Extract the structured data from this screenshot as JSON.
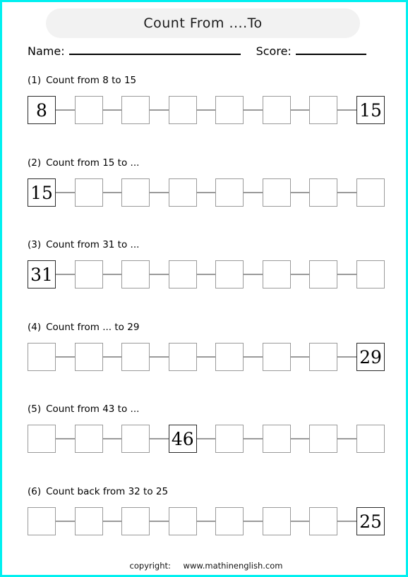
{
  "header": {
    "title": "Count From ....To",
    "name_label": "Name:",
    "score_label": "Score:"
  },
  "questions": [
    {
      "number": "(1)",
      "text": "Count from 8 to 15",
      "cells": [
        "8",
        "",
        "",
        "",
        "",
        "",
        "",
        "15"
      ]
    },
    {
      "number": "(2)",
      "text": "Count from 15 to ...",
      "cells": [
        "15",
        "",
        "",
        "",
        "",
        "",
        "",
        ""
      ]
    },
    {
      "number": "(3)",
      "text": "Count from 31 to ...",
      "cells": [
        "31",
        "",
        "",
        "",
        "",
        "",
        "",
        ""
      ]
    },
    {
      "number": "(4)",
      "text": "Count from ... to 29",
      "cells": [
        "",
        "",
        "",
        "",
        "",
        "",
        "",
        "29"
      ]
    },
    {
      "number": "(5)",
      "text": "Count from 43 to ...",
      "cells": [
        "",
        "",
        "",
        "46",
        "",
        "",
        "",
        ""
      ]
    },
    {
      "number": "(6)",
      "text": "Count back from 32 to 25",
      "cells": [
        "",
        "",
        "",
        "",
        "",
        "",
        "",
        "25"
      ]
    }
  ],
  "footer": {
    "copyright_label": "copyright:",
    "site": "www.mathinenglish.com"
  },
  "layout": {
    "question_tops": [
      103,
      220,
      336,
      453,
      569,
      686
    ]
  },
  "colors": {
    "page_border": "#00f0f0",
    "title_bg": "#f2f2f2",
    "cell_border_empty": "#9a9a9a",
    "cell_border_filled": "#2a2a2a"
  }
}
